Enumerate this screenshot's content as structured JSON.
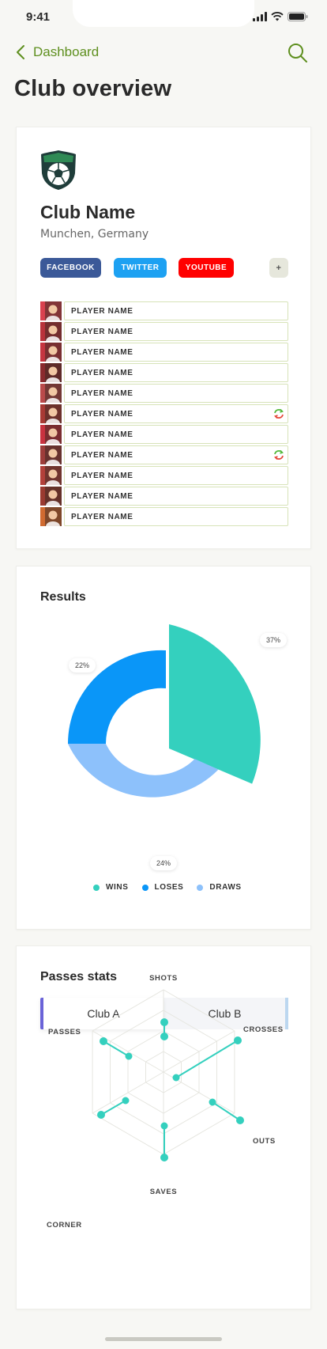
{
  "status": {
    "time": "9:41"
  },
  "nav": {
    "back_label": "Dashboard"
  },
  "page": {
    "title": "Club overview"
  },
  "club": {
    "name": "Club Name",
    "location": "Munchen, Germany",
    "social": {
      "facebook": "FACEBOOK",
      "twitter": "TWITTER",
      "youtube": "YOUTUBE",
      "add": "+"
    },
    "players": [
      {
        "name": "PLAYER NAME",
        "sync": false,
        "color": "#d9414f"
      },
      {
        "name": "PLAYER NAME",
        "sync": false,
        "color": "#b8323b"
      },
      {
        "name": "PLAYER NAME",
        "sync": false,
        "color": "#c53540"
      },
      {
        "name": "PLAYER NAME",
        "sync": false,
        "color": "#8a2a2e"
      },
      {
        "name": "PLAYER NAME",
        "sync": false,
        "color": "#b94a4a"
      },
      {
        "name": "PLAYER NAME",
        "sync": true,
        "color": "#a83a34"
      },
      {
        "name": "PLAYER NAME",
        "sync": false,
        "color": "#c8323f"
      },
      {
        "name": "PLAYER NAME",
        "sync": true,
        "color": "#9d3d3a"
      },
      {
        "name": "PLAYER NAME",
        "sync": false,
        "color": "#b2403a"
      },
      {
        "name": "PLAYER NAME",
        "sync": false,
        "color": "#9a3a30"
      },
      {
        "name": "PLAYER NAME",
        "sync": false,
        "color": "#d06a30"
      }
    ]
  },
  "results": {
    "title": "Results",
    "labels": {
      "wins_pct": "37%",
      "loses_pct": "22%",
      "draws_pct": "24%"
    },
    "legend": [
      {
        "label": "WINS",
        "color": "#34d0be"
      },
      {
        "label": "LOSES",
        "color": "#0a96f8"
      },
      {
        "label": "DRAWS",
        "color": "#8dc1fb"
      }
    ]
  },
  "passes": {
    "title": "Passes stats",
    "tabs": {
      "a": "Club A",
      "b": "Club B"
    },
    "axes": {
      "shots": "SHOTS",
      "crosses": "CROSSES",
      "outs": "OUTS",
      "saves": "SAVES",
      "corner": "CORNER",
      "passes": "PASSES"
    }
  },
  "colors": {
    "accent": "#5e8f1e",
    "teal": "#34d0be",
    "blue": "#0a96f8",
    "light_blue": "#8dc1fb"
  }
}
